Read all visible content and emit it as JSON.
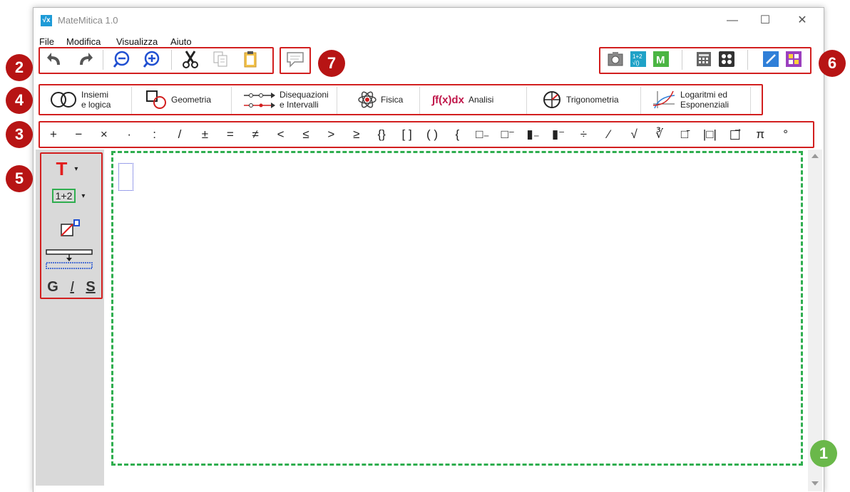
{
  "window": {
    "title": "MateMitica 1.0",
    "app_icon_text": "√x",
    "minimize_glyph": "—",
    "maximize_glyph": "☐",
    "close_glyph": "✕"
  },
  "menubar": {
    "items": [
      "File",
      "Modifica",
      "Visualizza",
      "Aiuto"
    ]
  },
  "toolbar": {
    "icons": [
      "undo-icon",
      "redo-icon",
      "zoom-out-icon",
      "zoom-in-icon",
      "cut-icon",
      "copy-icon",
      "paste-icon",
      "comment-icon"
    ],
    "right_icons": [
      "screenshot-icon",
      "formula-icon",
      "m-icon",
      "calculator-icon",
      "keypad-icon",
      "pen-icon",
      "grid-icon"
    ]
  },
  "tabs": [
    {
      "line1": "Insiemi",
      "line2": "e logica",
      "icon": "venn-icon"
    },
    {
      "line1": "Geometria",
      "line2": "",
      "icon": "shapes-icon"
    },
    {
      "line1": "Disequazioni",
      "line2": "e Intervalli",
      "icon": "interval-icon"
    },
    {
      "line1": "Fisica",
      "line2": "",
      "icon": "atom-icon"
    },
    {
      "line1": "Analisi",
      "line2": "",
      "icon": "integral-icon"
    },
    {
      "line1": "Trigonometria",
      "line2": "",
      "icon": "circle-icon"
    },
    {
      "line1": "Logaritmi ed",
      "line2": "Esponenziali",
      "icon": "log-graph-icon"
    }
  ],
  "integral_label": "∫f(x)dx",
  "symbols": [
    "+",
    "−",
    "×",
    "·",
    ":",
    "/",
    "±",
    "=",
    "≠",
    "<",
    "≤",
    ">",
    "≥",
    "{}",
    "[ ]",
    "( )",
    "{",
    "□₋",
    "□⁻",
    "▮₋",
    "▮⁻",
    "÷",
    "⁄",
    "√",
    "∛",
    "□̄",
    "|□|",
    "□⃗",
    "π",
    "°"
  ],
  "sidebar": {
    "text_tool": "T",
    "math_tool": "1+2",
    "dropdown_glyph": "▾",
    "bold": "G",
    "italic": "I",
    "strike": "S"
  },
  "badges": [
    "1",
    "2",
    "3",
    "4",
    "5",
    "6",
    "7"
  ],
  "colors": {
    "accent_red": "#d21f1f",
    "badge_red": "#b71414",
    "badge_green": "#6ab84a",
    "canvas_border": "#2fae4f",
    "sidebar_bg": "#d9d9d9"
  }
}
